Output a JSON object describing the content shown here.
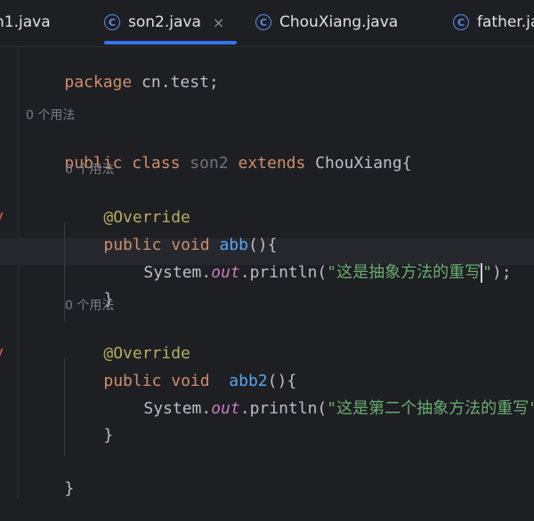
{
  "tabs": [
    {
      "label": "n1.java",
      "active": false,
      "icon": "class-icon"
    },
    {
      "label": "son2.java",
      "active": true,
      "icon": "class-icon",
      "close": "×"
    },
    {
      "label": "ChouXiang.java",
      "active": false,
      "icon": "class-icon"
    },
    {
      "label": "father.java",
      "active": false,
      "icon": "class-icon"
    }
  ],
  "tab_icon_glyph": "C",
  "code": {
    "package_kw": "package",
    "package_name": " cn.test;",
    "usage_hint_1": "0 个用法",
    "public_kw": "public",
    "class_kw": "class",
    "class_name": "son2",
    "extends_kw": "extends",
    "parent": "ChouXiang{",
    "usage_hint_2": "0 个用法",
    "override_1": "@Override",
    "method1_public": "public",
    "method1_void": "void",
    "method1_name": "abb",
    "method1_paren": "(){",
    "sys1": "System.",
    "out1": "out",
    "println1": ".println(",
    "str1_a": "\"这是抽象方法的重写",
    "str1_b": "\"",
    "end1": ");",
    "close_brace_1": "}",
    "usage_hint_3": "0 个用法",
    "override_2": "@Override",
    "method2_public": "public",
    "method2_void": "void",
    "method2_name": "abb2",
    "method2_paren": "(){",
    "sys2": "System.",
    "out2": "out",
    "println2": ".println(",
    "str2": "\"这是第二个抽象方法的重写\"",
    "end2": ");",
    "close_brace_2": "}",
    "close_brace_class": "}"
  },
  "colors": {
    "background": "#1e1f22",
    "keyword": "#cf8e6d",
    "annotation": "#b3ae60",
    "method": "#56a8f5",
    "field_out": "#c77dbb",
    "string": "#6aab73",
    "accent_tab": "#3574f0"
  }
}
